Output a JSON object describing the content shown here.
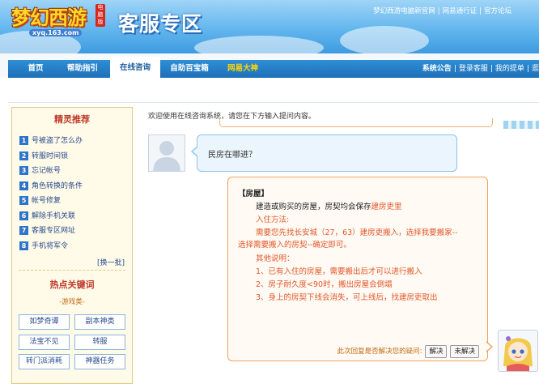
{
  "header": {
    "logo_text": "梦幻西游",
    "logo_badge": "电脑版",
    "logo_url": "xyq.163.com",
    "site_title": "客服专区",
    "top_links": [
      "梦幻西游电脑新官网",
      "网易通行证",
      "官方论坛"
    ]
  },
  "nav": {
    "items": [
      "首页",
      "帮助指引",
      "在线咨询",
      "自助百宝箱",
      "网易大神"
    ],
    "active": "在线咨询",
    "right": {
      "notice": "系统公告",
      "links": [
        "登录客服",
        "我的提单",
        "逛"
      ]
    }
  },
  "sidebar": {
    "title": "精灵推荐",
    "items": [
      {
        "num": "1",
        "label": "号被盗了怎么办"
      },
      {
        "num": "2",
        "label": "转服时间锁"
      },
      {
        "num": "3",
        "label": "忘记帐号"
      },
      {
        "num": "4",
        "label": "角色转换的条件"
      },
      {
        "num": "5",
        "label": "帐号修复"
      },
      {
        "num": "6",
        "label": "解除手机关联"
      },
      {
        "num": "7",
        "label": "客服专区网址"
      },
      {
        "num": "8",
        "label": "手机将军令"
      }
    ],
    "swap_label": "[换一批]",
    "hot_title": "热点关键词",
    "category": "-游戏类-",
    "keywords": [
      "如梦奇谭",
      "副本神类",
      "法宝不见",
      "转服",
      "转门派消耗",
      "神器任务"
    ]
  },
  "chat": {
    "welcome": "欢迎使用在线咨询系统，请您在下方输入提问内容。",
    "user_question": "民房在哪进？",
    "reply": {
      "title": "【房屋】",
      "l1a": "建造或购买的房屋，房契均会保存",
      "l1b": "建房吏里",
      "l2": "入住方法:",
      "l3": "需要您先找长安城（27，63）建房吏搬入，选择我要搬家--",
      "l4": "选择需要搬入的房契--确定即可。",
      "l5": "其他说明：",
      "l6": "1、已有入住的房屋，需要搬出后才可以进行搬入",
      "l7": "2、房子耐久度<90时，搬出房屋会倒塌",
      "l8": "3、身上的房契下线会消失，可上线后，找建房吏取出"
    },
    "feedback_prompt": "此次回复是否解决您的疑问:",
    "solved_label": "解决",
    "unsolved_label": "未解决"
  },
  "colors": {
    "accent": "#1d6fb8",
    "reply_border": "#f0a35e",
    "reply_red": "#e2572b",
    "title_red": "#c0392b"
  }
}
